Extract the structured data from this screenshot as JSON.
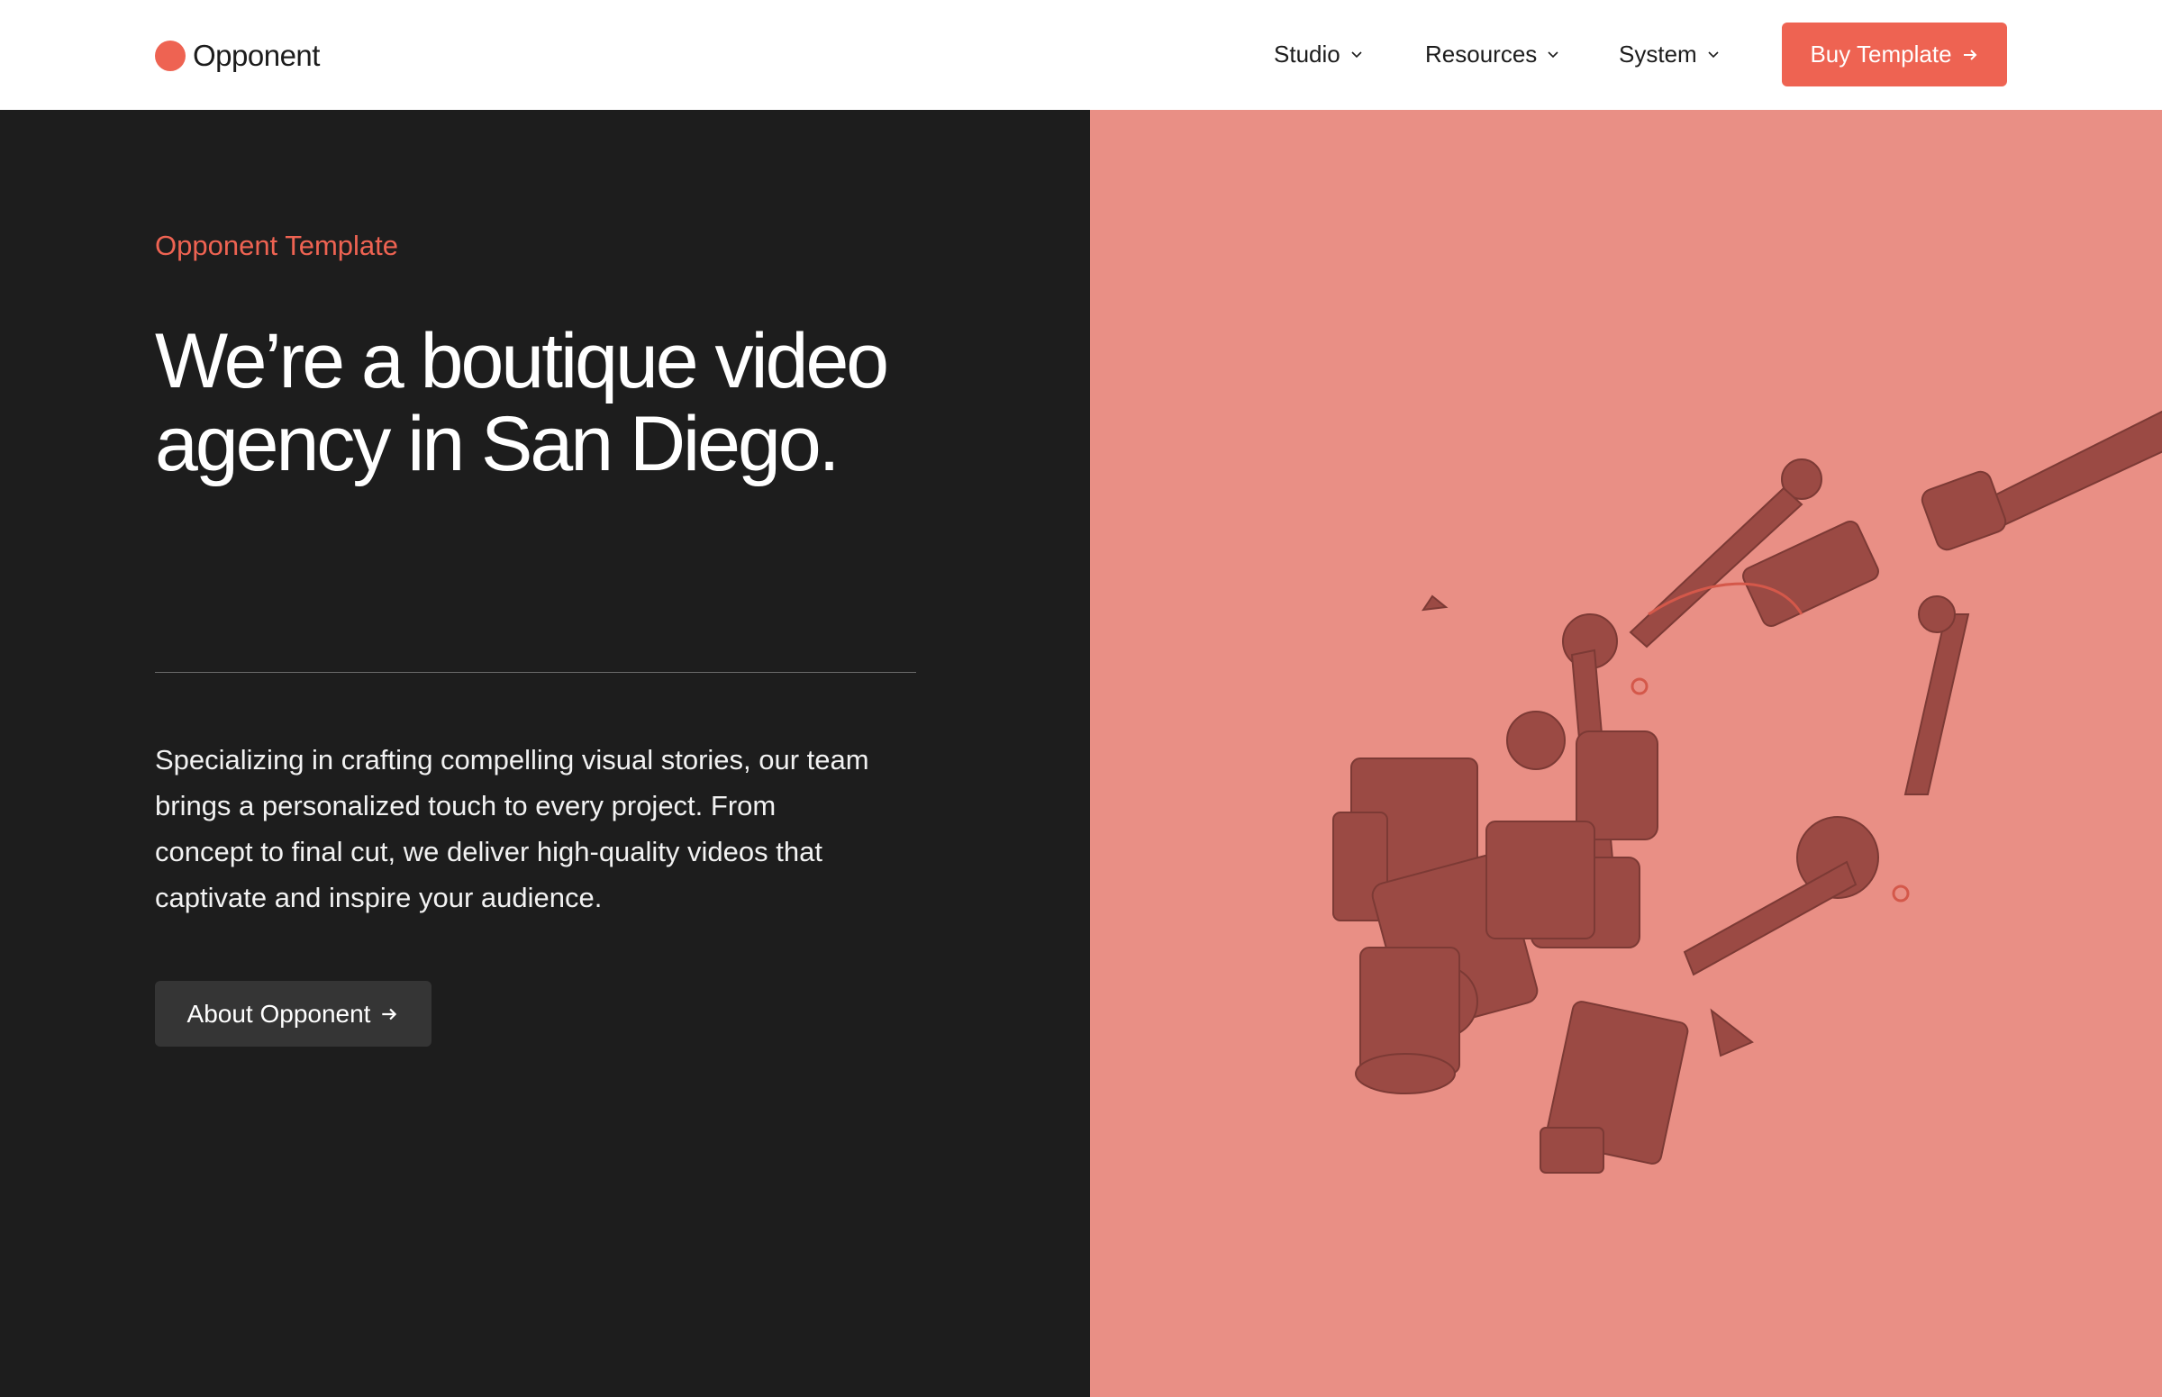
{
  "brand": {
    "name": "Opponent",
    "accent_color": "#ee6352",
    "dark_bg": "#1d1d1d",
    "image_tint": "#e98f85"
  },
  "nav": {
    "items": [
      {
        "label": "Studio",
        "icon": "chevron-down-icon"
      },
      {
        "label": "Resources",
        "icon": "chevron-down-icon"
      },
      {
        "label": "System",
        "icon": "chevron-down-icon"
      }
    ],
    "cta": {
      "label": "Buy Template",
      "icon": "arrow-right-icon"
    }
  },
  "hero": {
    "eyebrow": "Opponent Template",
    "headline_line1": "We’re a boutique video",
    "headline_line2": "agency in San Diego.",
    "body_line1": "Specializing in crafting compelling visual stories, our team",
    "body_line2": "brings a personalized touch to every project. From",
    "body_line3": "concept to final cut, we deliver high-quality videos that",
    "body_line4": "captivate and inspire your audience.",
    "button": {
      "label": "About Opponent",
      "icon": "arrow-right-icon"
    },
    "image": {
      "subject": "camera-rig-image"
    }
  }
}
